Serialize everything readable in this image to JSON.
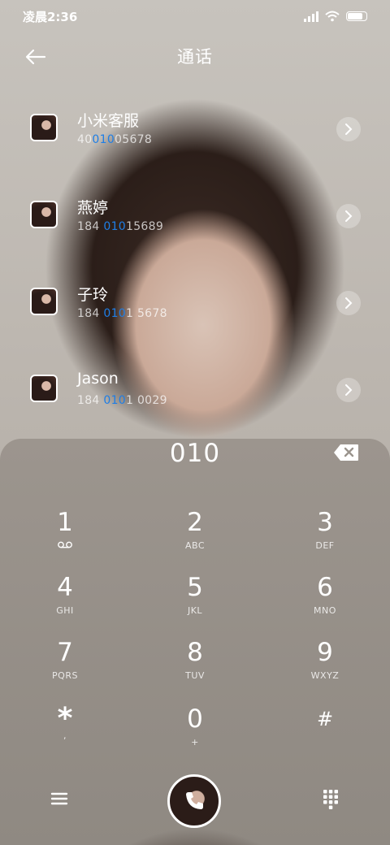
{
  "status_bar": {
    "time": "凌晨2:36"
  },
  "header": {
    "title": "通话",
    "back_icon": "arrow-left-icon"
  },
  "contacts": [
    {
      "name": "小米客服",
      "number_prefix": "40",
      "number_match": "010",
      "number_suffix": "05678"
    },
    {
      "name": "燕婷",
      "number_prefix": "184 ",
      "number_match": "010",
      "number_suffix": "15689"
    },
    {
      "name": "子玲",
      "number_prefix": "184 ",
      "number_match": "010",
      "number_suffix": "1 5678"
    },
    {
      "name": "Jason",
      "number_prefix": "184 ",
      "number_match": "010",
      "number_suffix": "1 0029"
    }
  ],
  "dial": {
    "input": "010",
    "delete_icon": "backspace-icon"
  },
  "keypad": [
    {
      "digit": "1",
      "letters": "voicemail"
    },
    {
      "digit": "2",
      "letters": "ABC"
    },
    {
      "digit": "3",
      "letters": "DEF"
    },
    {
      "digit": "4",
      "letters": "GHI"
    },
    {
      "digit": "5",
      "letters": "JKL"
    },
    {
      "digit": "6",
      "letters": "MNO"
    },
    {
      "digit": "7",
      "letters": "PQRS"
    },
    {
      "digit": "8",
      "letters": "TUV"
    },
    {
      "digit": "9",
      "letters": "WXYZ"
    },
    {
      "digit": "*",
      "letters": ","
    },
    {
      "digit": "0",
      "letters": "+"
    },
    {
      "digit": "#",
      "letters": ""
    }
  ],
  "bottom_bar": {
    "menu_icon": "menu-icon",
    "call_icon": "phone-icon",
    "keypad_icon": "dialpad-icon"
  },
  "colors": {
    "highlight": "#1e7ee6",
    "text": "#ffffff"
  }
}
